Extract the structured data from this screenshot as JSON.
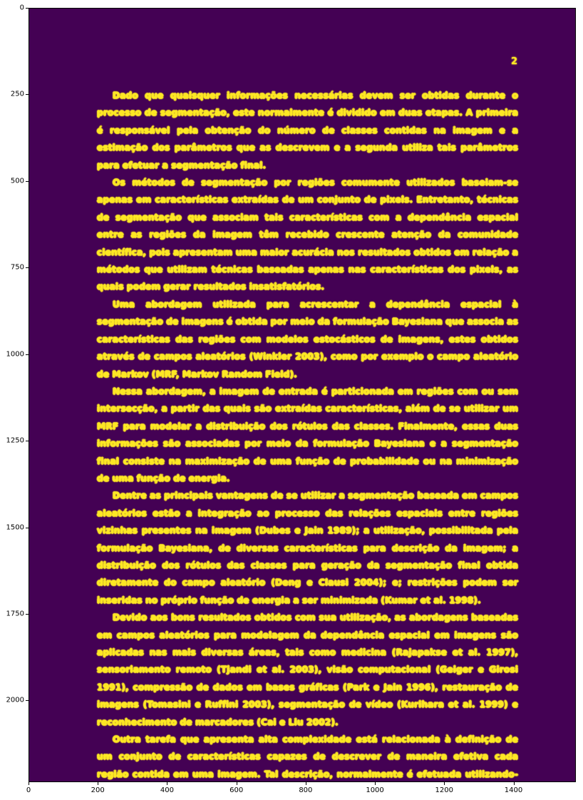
{
  "page_number": "2",
  "paragraphs": [
    "Dado que quaisquer informações necessárias devem ser obtidas durante o processo de segmentação, este normalmente é dividido em duas etapas. A primeira é responsável pela obtenção do número de classes contidas na imagem e a estimação dos parâmetros que as descrevem e a segunda utiliza tais parâmetros para efetuar a segmentação final.",
    "Os métodos de segmentação por regiões comumente utilizados baseiam-se apenas em características extraídas de um conjunto de pixels. Entretanto, técnicas de segmentação que associam tais características com a dependência espacial entre as regiões da imagem têm recebido crescente atenção da comunidade científica, pois apresentam uma maior acurácia nos resultados obtidos em relação a métodos que utilizam técnicas baseadas apenas nas características dos pixels, as quais podem gerar resultados insatisfatórios.",
    "Uma abordagem utilizada para acrescentar a dependência espacial à segmentação de imagens é obtida por meio da formulação Bayesiana que associa as características das regiões com modelos estocásticos de imagens, estes obtidos através de campos aleatórios (Winkler 2003), como por exemplo o campo aleatório de Markov (MRF, Markov Random Field).",
    "Nessa abordagem, a imagem de entrada é particionada em regiões com ou sem intersecção, a partir das quais são extraídas características, além de se utilizar um MRF para modelar a distribuição dos rótulos das classes. Finalmente, essas duas informações são associadas por meio da formulação Bayesiana e a segmentação final consiste na maximização de uma função de probabilidade ou na minimização de uma função de energia.",
    "Dentre as principais vantagens de se utilizar a segmentação baseada em campos aleatórios estão a integração ao processo das relações espaciais entre regiões vizinhas presentes na imagem (Dubes e Jain 1989); a utilização, possibilitada pela formulação Bayesiana, de diversas características para descrição da imagem; a distribuição dos rótulos das classes para geração da segmentação final obtida diretamente do campo aleatório (Deng e Clausi 2004); e; restrições podem ser inseridas no próprio função de energia a ser minimizada (Kumar et al. 1998).",
    "Devido aos bons resultados obtidos com sua utilização, as abordagens baseadas em campos aleatórios para modelagem da dependência espacial em imagens são aplicadas nas mais diversas áreas, tais como medicina (Rajapakse et al. 1997), sensoriamento remoto (Tjandi et al. 2003), visão computacional (Geiger e Girosi 1991), compressão de dados em bases gráficas (Park e Jain 1996), restauração de imagens (Tomasini e Ruffini 2003), segmentação de vídeo (Kurihara et al. 1999) e reconhecimento de marcadores (Cai e Liu 2002).",
    "Outra tarefa que apresenta alta complexidade está relacionada à definição de um conjunto de características capazes de descrever de maneira efetiva cada região contida em uma imagem. Tal descrição, normalmente é efetuada utilizando-se informações obtidas a partir de"
  ],
  "axes": {
    "x_ticks": [
      "0",
      "200",
      "400",
      "600",
      "800",
      "1000",
      "1200",
      "1400"
    ],
    "y_ticks": [
      "0",
      "250",
      "500",
      "750",
      "1000",
      "1250",
      "1500",
      "1750",
      "2000"
    ]
  },
  "colors": {
    "background": "#440154",
    "foreground": "#fde725"
  }
}
